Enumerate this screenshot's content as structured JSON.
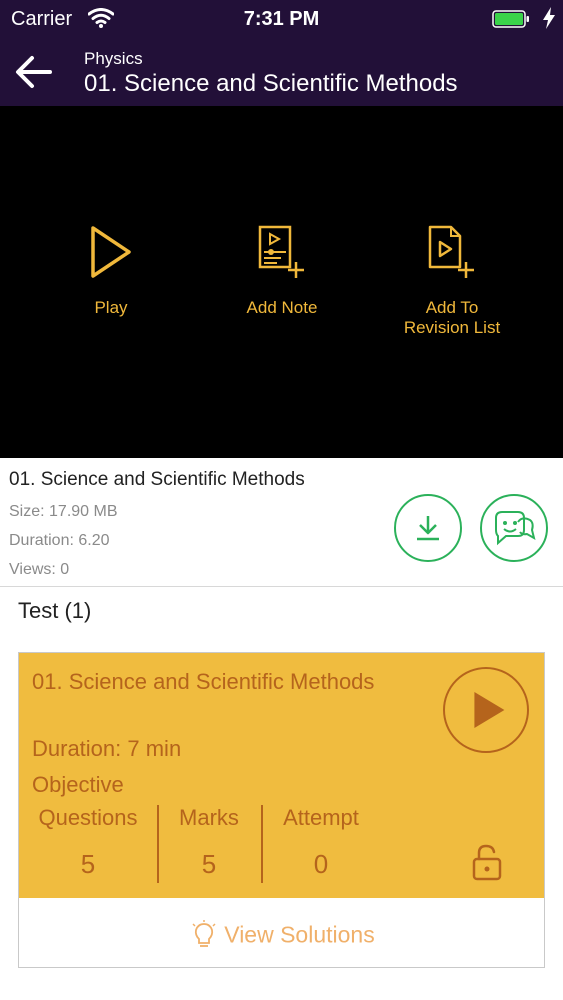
{
  "status_bar": {
    "carrier": "Carrier",
    "time": "7:31 PM"
  },
  "nav": {
    "subject": "Physics",
    "title": "01. Science and Scientific Methods"
  },
  "player_actions": [
    {
      "label": "Play",
      "icon": "play-icon"
    },
    {
      "label": "Add Note",
      "icon": "add-note-icon"
    },
    {
      "label_line1": "Add To",
      "label_line2": "Revision List",
      "icon": "add-to-revision-icon"
    }
  ],
  "video_info": {
    "title": "01. Science and Scientific Methods",
    "size": "Size: 17.90 MB",
    "duration": "Duration: 6.20",
    "views": "Views: 0"
  },
  "test_section": {
    "heading": "Test (1)",
    "card": {
      "title": "01. Science and Scientific Methods",
      "duration": "Duration:  7 min",
      "type": "Objective",
      "stats": [
        {
          "label": "Questions",
          "value": "5"
        },
        {
          "label": "Marks",
          "value": "5"
        },
        {
          "label": "Attempt",
          "value": "0"
        }
      ]
    },
    "view_solutions_label": "View Solutions"
  },
  "colors": {
    "header_bg": "#221038",
    "accent_gold": "#f0b83b",
    "card_bg": "#f0bc3f",
    "card_text": "#b5641c",
    "green": "#2bb15a",
    "solutions_text": "#f0b06a"
  }
}
